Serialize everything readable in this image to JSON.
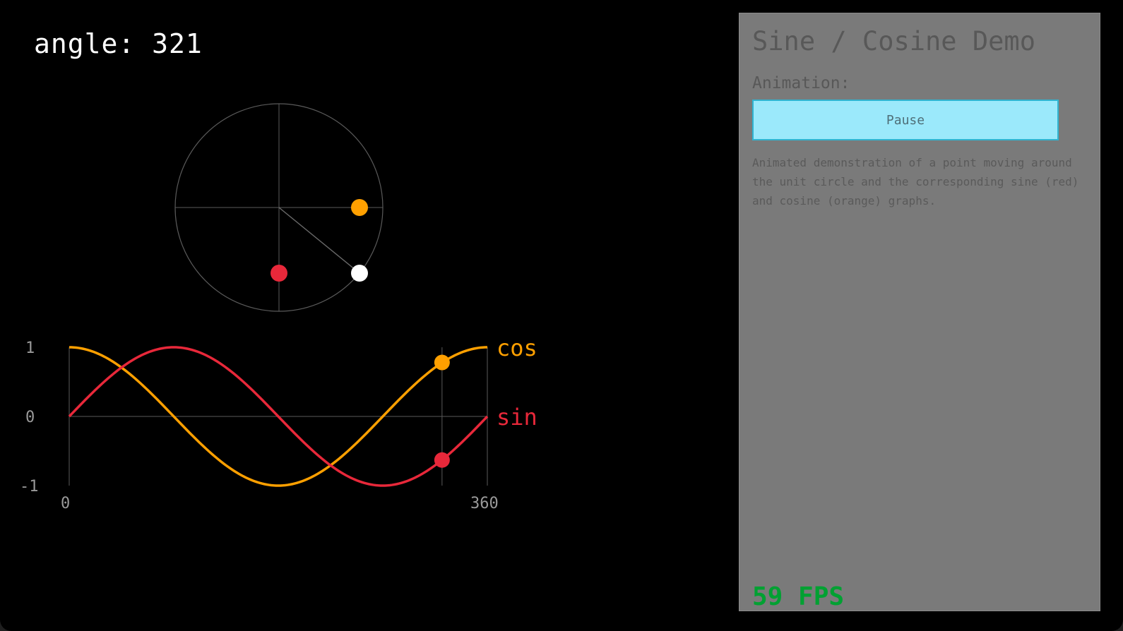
{
  "angle_readout": "angle: 321",
  "panel": {
    "title": "Sine / Cosine Demo",
    "animation_label": "Animation:",
    "pause_button_label": "Pause",
    "description": "Animated demonstration of a point moving around the unit circle and the corresponding sine (red) and cosine (orange) graphs.",
    "fps_text": "59 FPS"
  },
  "colors": {
    "sine": "#e8283a",
    "cosine": "#ffa000",
    "point": "#ffffff",
    "fps": "#00a132",
    "button_bg": "#9be9fb",
    "panel_bg": "#7a7a7a"
  },
  "unit_circle": {
    "angle_degrees": 321
  },
  "chart_data": {
    "type": "line",
    "x": [
      0,
      360
    ],
    "xlim": [
      0,
      360
    ],
    "ylim": [
      -1,
      1
    ],
    "x_tick_labels": [
      "0",
      "360"
    ],
    "y_tick_labels": [
      "1",
      "0",
      "-1"
    ],
    "series": [
      {
        "name": "cos",
        "function": "cos(x)",
        "color": "#ffa000"
      },
      {
        "name": "sin",
        "function": "sin(x)",
        "color": "#e8283a"
      }
    ],
    "current_angle": 321,
    "current_values": {
      "sin": -0.63,
      "cos": 0.78
    }
  }
}
